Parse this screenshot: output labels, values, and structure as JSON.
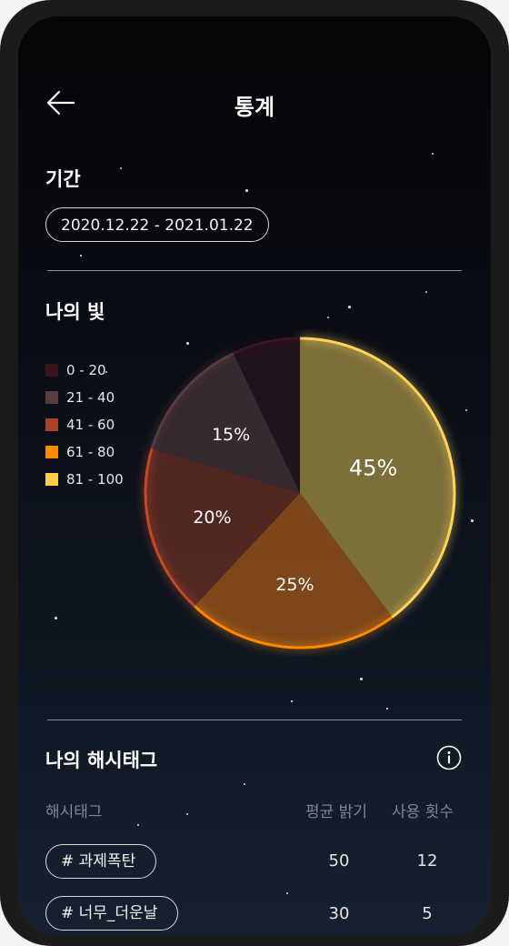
{
  "header": {
    "title": "통계"
  },
  "period": {
    "label": "기간",
    "range": "2020.12.22  -  2021.01.22"
  },
  "my_light": {
    "label": "나의 빛",
    "legend": [
      {
        "label": "0 - 20",
        "color": "#3a1520"
      },
      {
        "label": "21 - 40",
        "color": "#5a3b3e"
      },
      {
        "label": "41 - 60",
        "color": "#a8442a"
      },
      {
        "label": "61 - 80",
        "color": "#ff8a00"
      },
      {
        "label": "81 - 100",
        "color": "#ffcf4a"
      }
    ]
  },
  "chart_data": {
    "type": "pie",
    "slices": [
      {
        "range": "81 - 100",
        "value": 45,
        "label": "45%",
        "color": "#8a7a3e",
        "stroke": "#ffd35a"
      },
      {
        "range": "61 - 80",
        "value": 25,
        "label": "25%",
        "color": "#8a4c1a",
        "stroke": "#ff8a00"
      },
      {
        "range": "41 - 60",
        "value": 20,
        "label": "20%",
        "color": "#5a2a22",
        "stroke": "#c2492c"
      },
      {
        "range": "21 - 40",
        "value": 15,
        "label": "15%",
        "color": "#3a2d33",
        "stroke": "#5a3b3e"
      },
      {
        "range": "0 - 20",
        "value": 8,
        "label": "",
        "color": "#24141c",
        "stroke": "#3a1520"
      }
    ]
  },
  "hashtags": {
    "label": "나의 해시태그",
    "columns": {
      "tag": "해시태그",
      "brightness": "평균 밝기",
      "count": "사용 횟수"
    },
    "rows": [
      {
        "tag": "# 과제폭탄",
        "brightness": "50",
        "count": "12"
      },
      {
        "tag": "# 너무_더운날",
        "brightness": "30",
        "count": "5"
      }
    ]
  }
}
